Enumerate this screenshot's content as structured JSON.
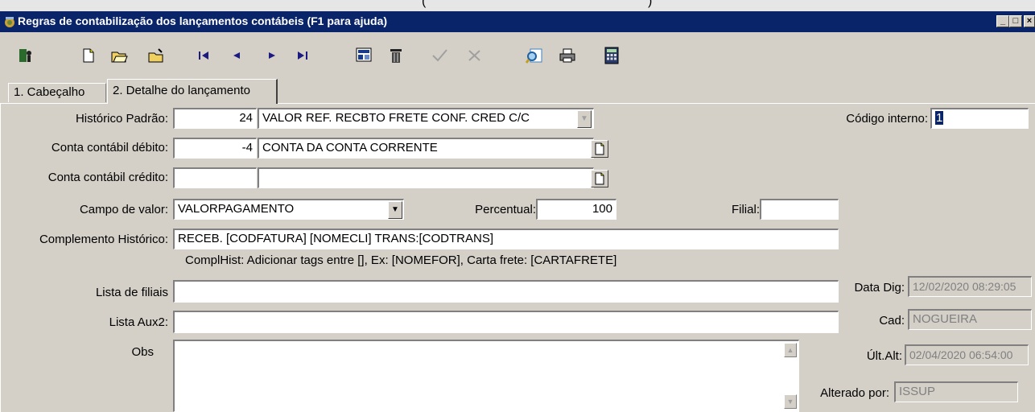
{
  "top_strip": {
    "left_paren": "(",
    "right_paren": ")"
  },
  "window": {
    "title": "Regras de contabilização dos lançamentos contábeis (F1 para ajuda)",
    "controls": {
      "minimize": "_",
      "maximize": "□",
      "close": "×"
    }
  },
  "toolbar": {
    "icons": [
      "exit-icon",
      "new-icon",
      "open-icon",
      "open-folder-icon",
      "first-record-icon",
      "previous-record-icon",
      "next-record-icon",
      "last-record-icon",
      "edit-icon",
      "delete-icon",
      "confirm-icon",
      "cancel-icon",
      "search-icon",
      "print-icon",
      "calculator-icon"
    ]
  },
  "tabs": [
    {
      "label": "1. Cabeçalho"
    },
    {
      "label": "2. Detalhe do lançamento"
    }
  ],
  "form": {
    "historico_padrao": {
      "label": "Histórico Padrão:",
      "code": "24",
      "description": "VALOR REF. RECBTO FRETE CONF. CRED C/C"
    },
    "codigo_interno": {
      "label": "Código interno:",
      "value": "1"
    },
    "conta_debito": {
      "label": "Conta contábil débito:",
      "code": "-4",
      "description": "CONTA DA CONTA CORRENTE"
    },
    "conta_credito": {
      "label": "Conta contábil crédito:",
      "code": "",
      "description": ""
    },
    "campo_valor": {
      "label": "Campo de valor:",
      "value": "VALORPAGAMENTO"
    },
    "percentual": {
      "label": "Percentual:",
      "value": "100"
    },
    "filial": {
      "label": "Filial:",
      "value": ""
    },
    "complemento": {
      "label": "Complemento Histórico:",
      "value": "RECEB. [CODFATURA] [NOMECLI] TRANS:[CODTRANS]"
    },
    "compl_hint": "ComplHist: Adicionar tags entre [], Ex: [NOMEFOR], Carta frete: [CARTAFRETE]",
    "lista_filiais": {
      "label": "Lista de filiais",
      "value": ""
    },
    "lista_aux2": {
      "label": "Lista Aux2:",
      "value": ""
    },
    "obs": {
      "label": "Obs",
      "value": ""
    },
    "data_dig": {
      "label": "Data Dig:",
      "value": "12/02/2020 08:29:05"
    },
    "cad": {
      "label": "Cad:",
      "value": "NOGUEIRA"
    },
    "ult_alt": {
      "label": "Últ.Alt:",
      "value": "02/04/2020 06:54:00"
    },
    "alterado_por": {
      "label": "Alterado por:",
      "value": "ISSUP"
    }
  }
}
